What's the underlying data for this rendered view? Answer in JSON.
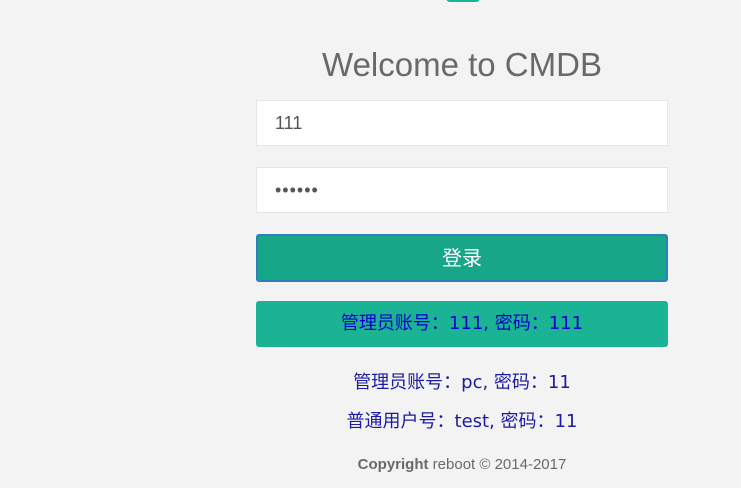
{
  "header": {
    "title": "Welcome to CMDB"
  },
  "form": {
    "username_value": "111",
    "password_value": "••••••",
    "login_label": "登录"
  },
  "accounts": {
    "admin_primary": "管理员账号：111, 密码：111",
    "admin_secondary": "管理员账号：pc, 密码：11",
    "normal_user": "普通用户号：test, 密码：11"
  },
  "footer": {
    "copyright_label": "Copyright",
    "copyright_text": "reboot © 2014-2017"
  },
  "colors": {
    "accent": "#1ab394",
    "button_dark": "#18a689",
    "link_blue": "#1a1aa6",
    "background": "#f3f3f4"
  }
}
